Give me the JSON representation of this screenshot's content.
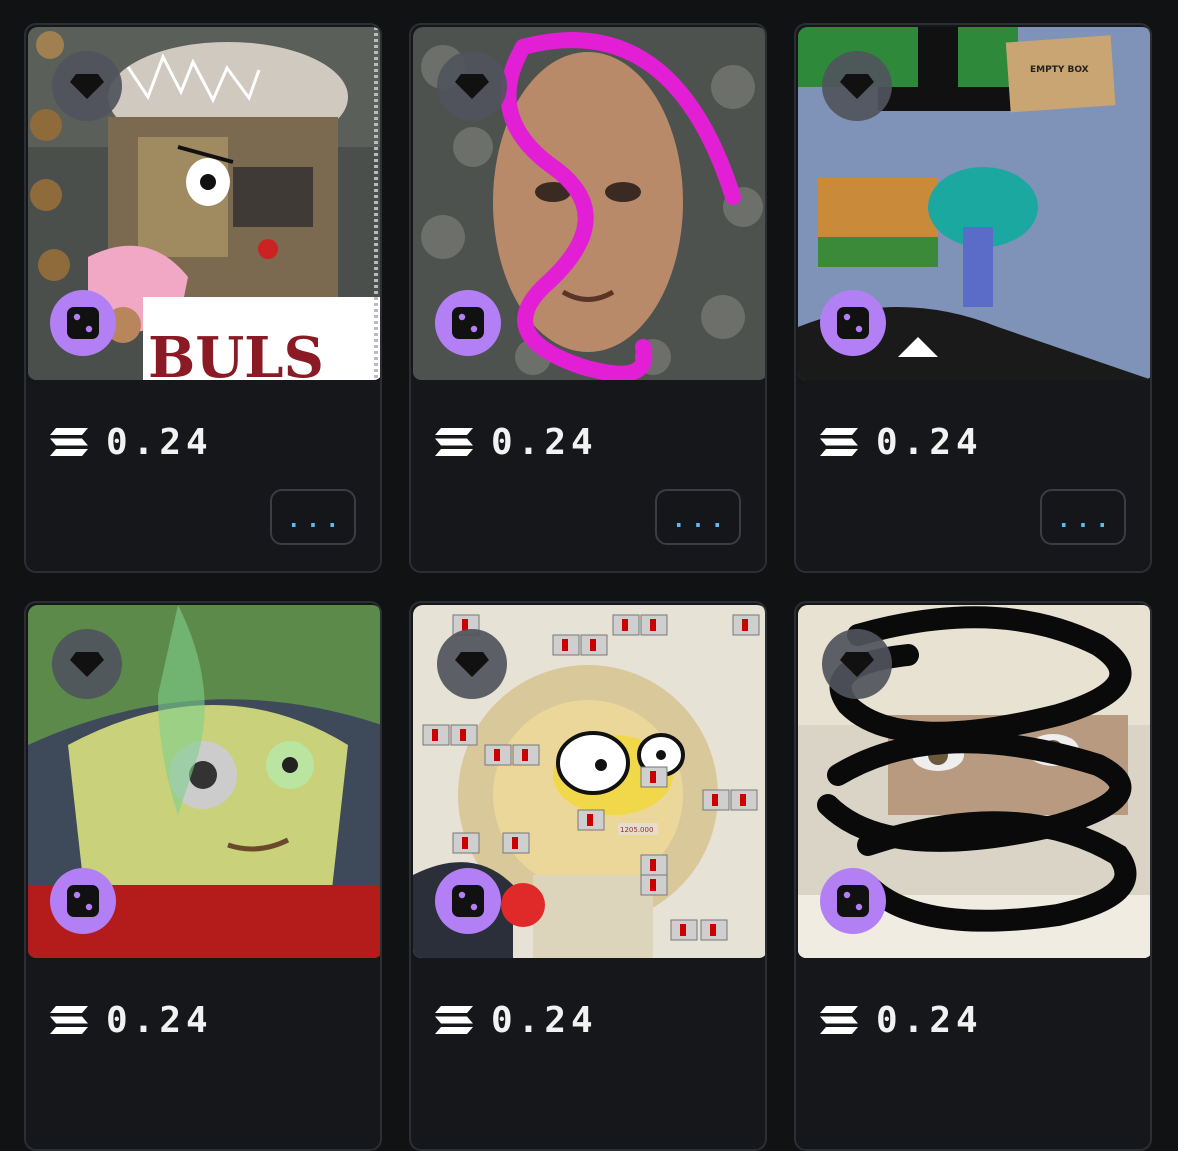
{
  "listings": [
    {
      "price": "0.24",
      "more_label": "...",
      "favorite_icon": "gem-icon",
      "random_icon": "dice-icon",
      "currency_icon": "solana-icon"
    },
    {
      "price": "0.24",
      "more_label": "...",
      "favorite_icon": "gem-icon",
      "random_icon": "dice-icon",
      "currency_icon": "solana-icon"
    },
    {
      "price": "0.24",
      "more_label": "...",
      "favorite_icon": "gem-icon",
      "random_icon": "dice-icon",
      "currency_icon": "solana-icon"
    },
    {
      "price": "0.24",
      "favorite_icon": "gem-icon",
      "random_icon": "dice-icon",
      "currency_icon": "solana-icon"
    },
    {
      "price": "0.24",
      "favorite_icon": "gem-icon",
      "random_icon": "dice-icon",
      "currency_icon": "solana-icon"
    },
    {
      "price": "0.24",
      "favorite_icon": "gem-icon",
      "random_icon": "dice-icon",
      "currency_icon": "solana-icon"
    }
  ],
  "artwork_text": {
    "empty_box_label": "EMPTY BOX",
    "jersey_text": "BULS",
    "tag_text": "1205.000"
  },
  "colors": {
    "background": "#111214",
    "card_border": "#2b2e33",
    "dice_badge": "#b37ff5",
    "gem_badge": "#50545c",
    "more_dots": "#5fb9ef",
    "price_text": "#f2f2f2"
  }
}
